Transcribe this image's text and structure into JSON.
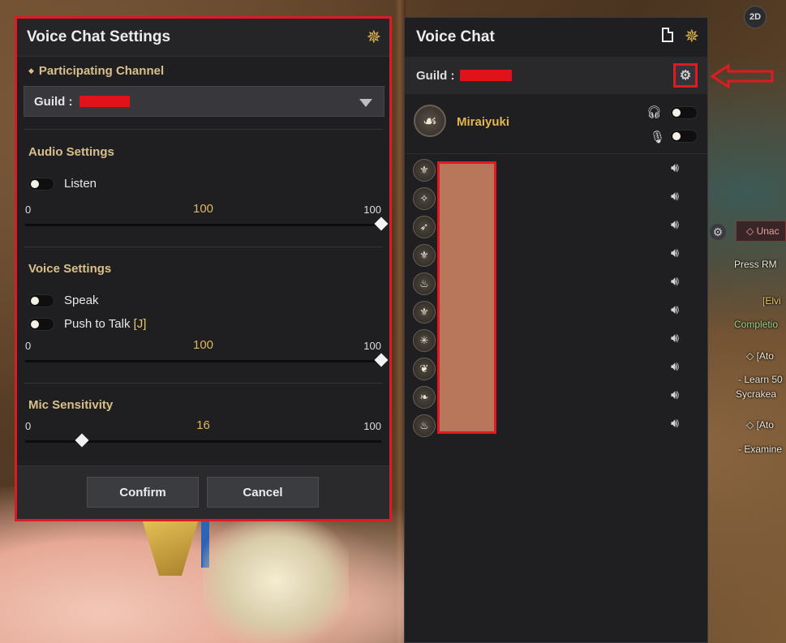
{
  "game_hud": {
    "view_mode_label": "2D",
    "quest_tag": "Unac",
    "quest_lines": [
      "Press RM",
      "[Elvi",
      "Completio",
      "[Ato",
      "- Learn 50",
      "Sycrakea",
      "[Ato",
      "- Examine"
    ]
  },
  "settings_panel": {
    "title": "Voice Chat Settings",
    "channel_heading": "Participating Channel",
    "channel_value_label": "Guild :",
    "audio": {
      "heading": "Audio Settings",
      "listen_label": "Listen",
      "listen_on": false,
      "min": "0",
      "max": "100",
      "value": "100",
      "fraction": 1.0
    },
    "voice": {
      "heading": "Voice Settings",
      "speak_label": "Speak",
      "speak_on": false,
      "ptt_label": "Push to Talk",
      "ptt_key": "[J]",
      "ptt_on": false,
      "min": "0",
      "max": "100",
      "value": "100",
      "fraction": 1.0
    },
    "mic": {
      "heading": "Mic Sensitivity",
      "min": "0",
      "max": "100",
      "value": "16",
      "fraction": 0.16
    },
    "confirm_label": "Confirm",
    "cancel_label": "Cancel"
  },
  "voice_panel": {
    "title": "Voice Chat",
    "guild_label": "Guild :",
    "self_name": "Miraiyuki",
    "headphone_on": false,
    "mic_on": false,
    "members": [
      {
        "icon": "crest-icon"
      },
      {
        "icon": "compass-icon"
      },
      {
        "icon": "bow-icon"
      },
      {
        "icon": "crest-icon"
      },
      {
        "icon": "flame-icon"
      },
      {
        "icon": "crest-icon"
      },
      {
        "icon": "star-icon"
      },
      {
        "icon": "fan-icon"
      },
      {
        "icon": "wing-icon"
      },
      {
        "icon": "flame-icon"
      }
    ]
  },
  "colors": {
    "accent_gold": "#e3b64b",
    "highlight_red": "#e01a22",
    "panel_bg": "#1f1f22"
  }
}
